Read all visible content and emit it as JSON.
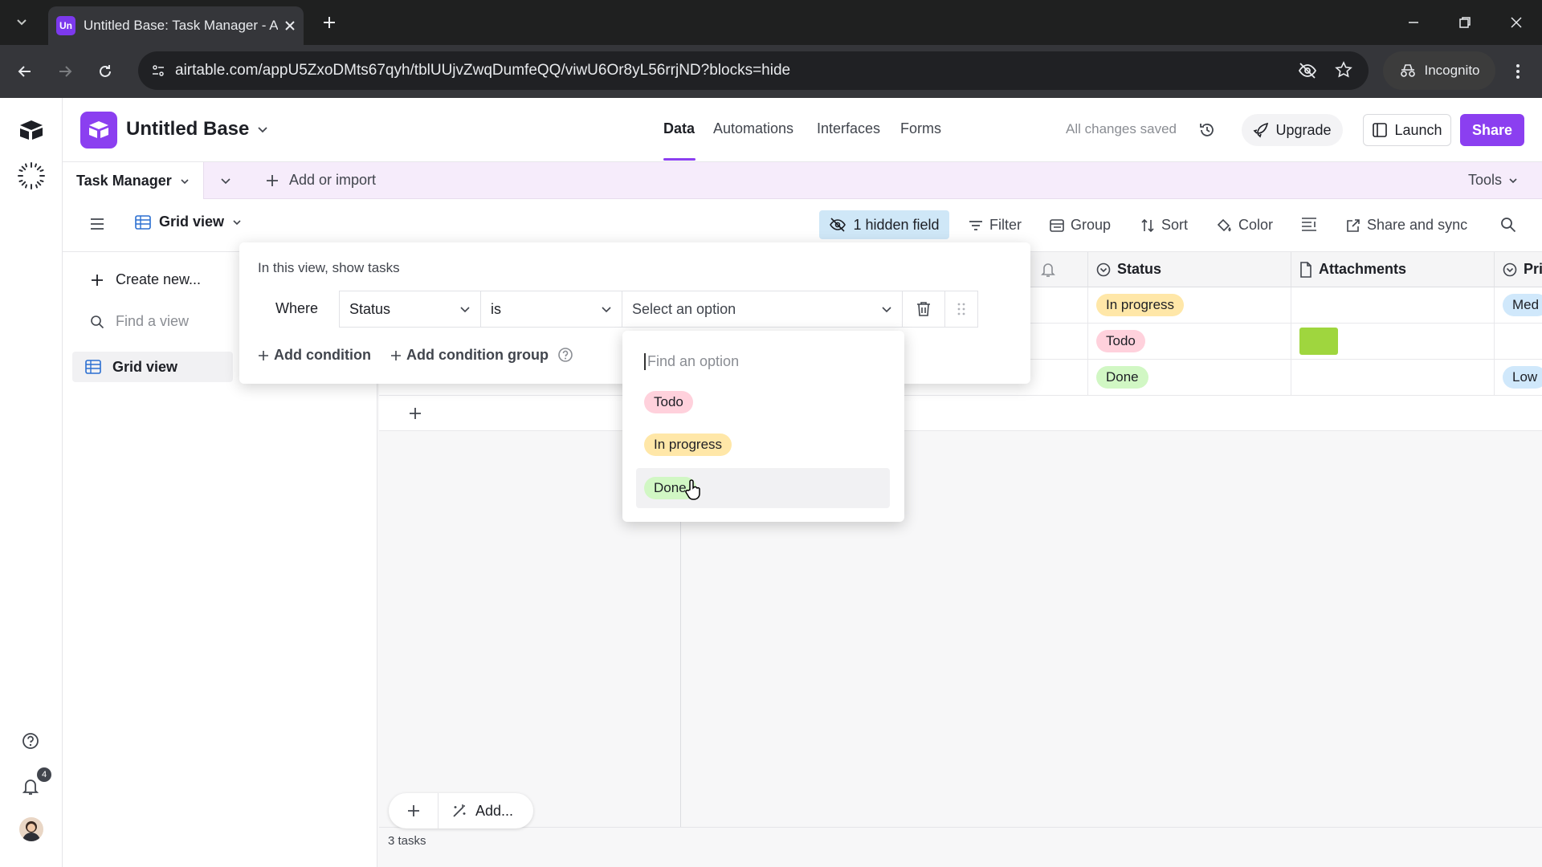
{
  "browser": {
    "tab_title": "Untitled Base: Task Manager - A",
    "tab_favicon": "Un",
    "url": "airtable.com/appU5ZxoDMts67qyh/tblUUjvZwqDumfeQQ/viwU6Or8yL56rrjND?blocks=hide",
    "incognito_label": "Incognito"
  },
  "header": {
    "base_name": "Untitled Base",
    "nav": [
      "Data",
      "Automations",
      "Interfaces",
      "Forms"
    ],
    "saved_status": "All changes saved",
    "upgrade": "Upgrade",
    "launch": "Launch",
    "share": "Share",
    "accent": "#8b3ff0"
  },
  "tablebar": {
    "table_name": "Task Manager",
    "add_import": "Add or import",
    "tools": "Tools"
  },
  "viewbar": {
    "view_name": "Grid view",
    "hidden_field": "1 hidden field",
    "filter": "Filter",
    "group": "Group",
    "sort": "Sort",
    "color": "Color",
    "share_sync": "Share and sync"
  },
  "sidebar": {
    "create_new": "Create new...",
    "find_view": "Find a view",
    "views": [
      "Grid view"
    ]
  },
  "grid": {
    "columns": [
      "Status",
      "Attachments",
      "Pri"
    ],
    "rows": [
      {
        "status": "In progress",
        "priority": "Med"
      },
      {
        "status": "Todo",
        "priority": ""
      },
      {
        "status": "Done",
        "priority": "Low"
      }
    ],
    "add_label": "Add...",
    "count": "3 tasks"
  },
  "filter": {
    "heading": "In this view, show tasks",
    "where": "Where",
    "field": "Status",
    "operator": "is",
    "value_placeholder": "Select an option",
    "add_condition": "Add condition",
    "add_condition_group": "Add condition group"
  },
  "dropdown": {
    "search_placeholder": "Find an option",
    "options": [
      "Todo",
      "In progress",
      "Done"
    ]
  },
  "notifications": {
    "badge": "4"
  }
}
